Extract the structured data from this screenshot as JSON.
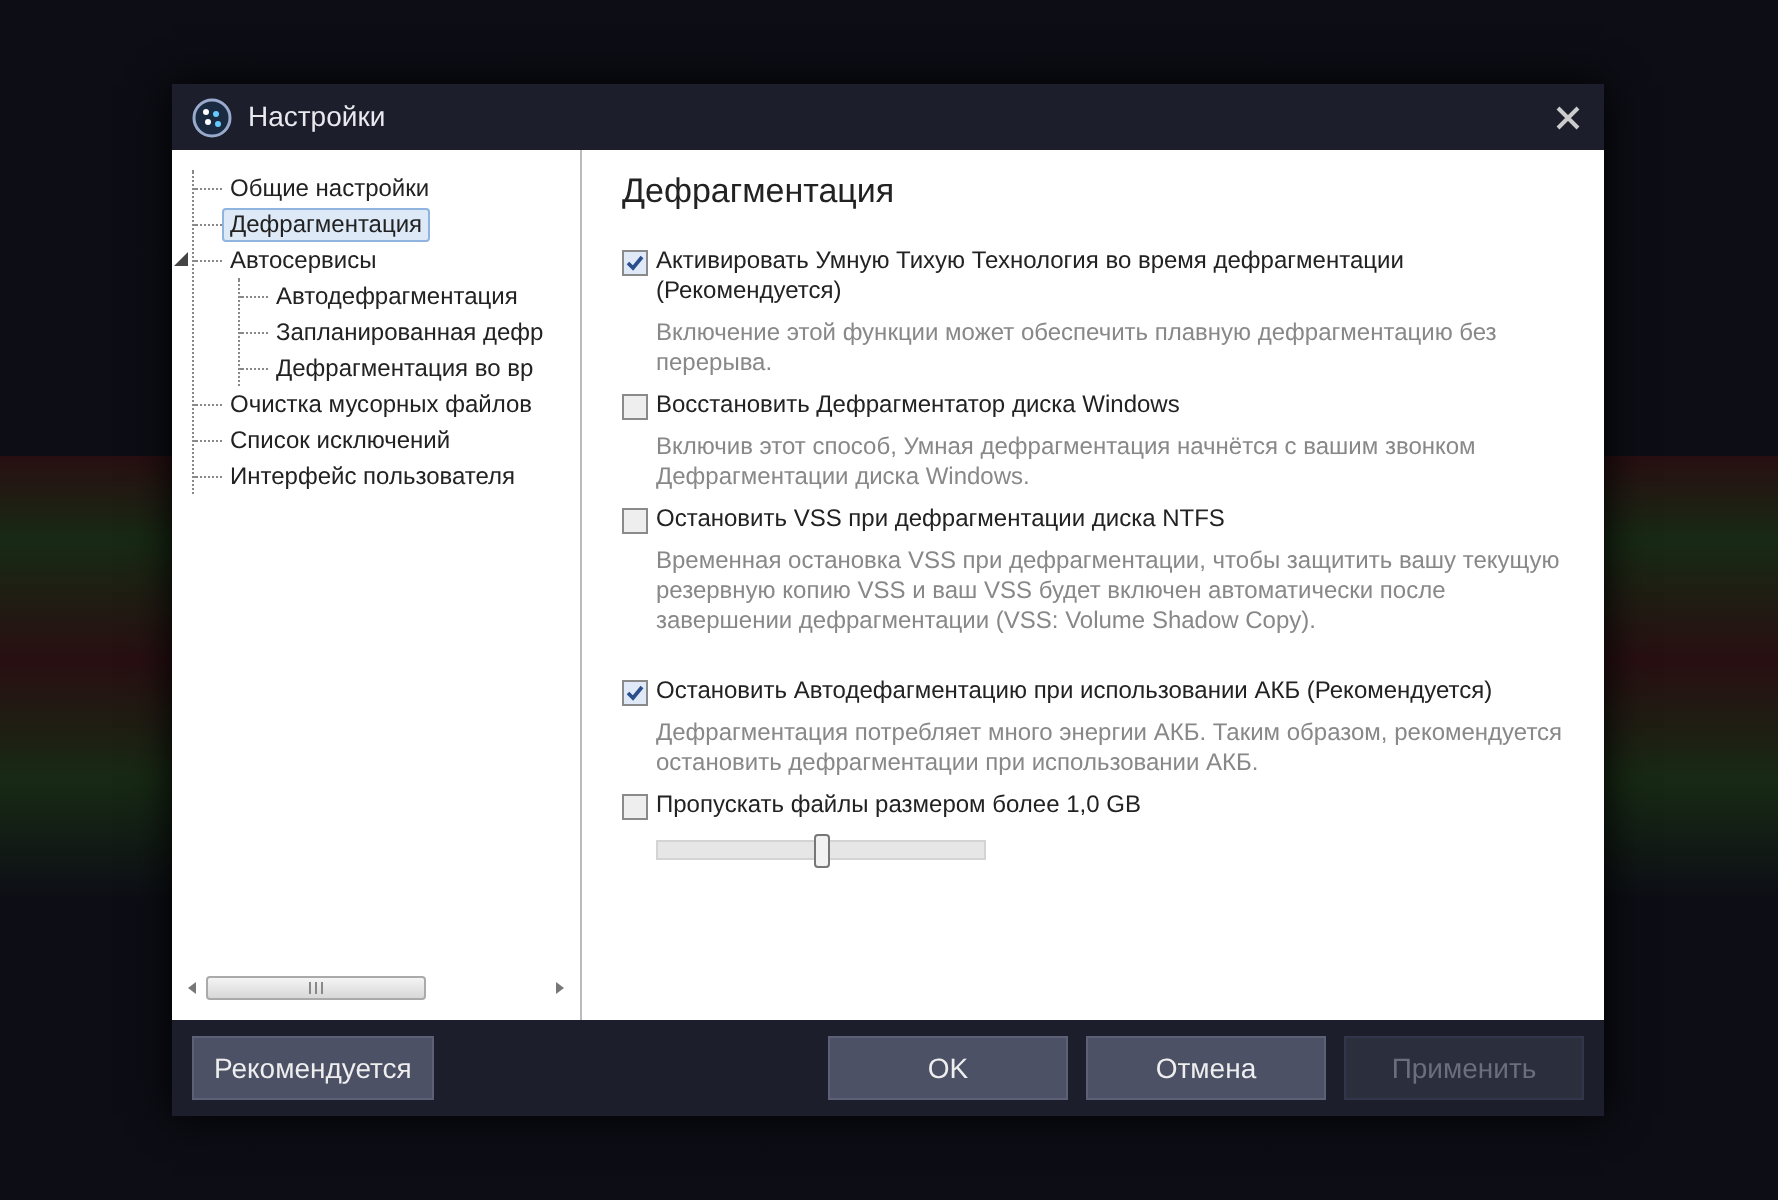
{
  "window": {
    "title": "Настройки"
  },
  "tree": [
    {
      "label": "Общие настройки",
      "selected": false
    },
    {
      "label": "Дефрагментация",
      "selected": true
    },
    {
      "label": "Автосервисы",
      "selected": false,
      "expanded": true,
      "children": [
        {
          "label": "Автодефрагментация",
          "selected": false
        },
        {
          "label": "Запланированная дефр",
          "selected": false
        },
        {
          "label": "Дефрагментация во вр",
          "selected": false
        }
      ]
    },
    {
      "label": "Очистка мусорных файлов",
      "selected": false
    },
    {
      "label": "Список исключений",
      "selected": false
    },
    {
      "label": "Интерфейс пользователя",
      "selected": false
    }
  ],
  "section_title": "Дефрагментация",
  "options": [
    {
      "label": "Активировать Умную Тихую Технология во время дефрагментации (Рекомендуется)",
      "checked": true,
      "description": "Включение этой функции может обеспечить плавную дефрагментацию без перерыва."
    },
    {
      "label": "Восстановить Дефрагментатор диска Windows",
      "checked": false,
      "description": "Включив этот способ, Умная дефрагментация начнётся с вашим звонком Дефрагментации диска Windows."
    },
    {
      "label": "Остановить VSS при дефрагментации диска NTFS",
      "checked": false,
      "description": "Временная остановка VSS при дефрагментации, чтобы защитить вашу текущую резервную копию VSS и ваш VSS будет включен автоматически после завершении дефрагментации (VSS: Volume Shadow Copy)."
    },
    {
      "label": "Остановить Автодефагментацию при использовании АКБ (Рекомендуется)",
      "checked": true,
      "description": "Дефрагментация потребляет много энергии АКБ. Таким образом, рекомендуется остановить дефрагментации при использовании АКБ."
    },
    {
      "label": "Пропускать файлы размером более 1,0 GB",
      "checked": false,
      "slider": {
        "level": 0.5
      }
    }
  ],
  "buttons": [
    {
      "label": "Рекомендуется",
      "disabled": false
    },
    {
      "label": "OK",
      "disabled": false
    },
    {
      "label": "Отмена",
      "disabled": false
    },
    {
      "label": "Применить",
      "disabled": true
    }
  ]
}
